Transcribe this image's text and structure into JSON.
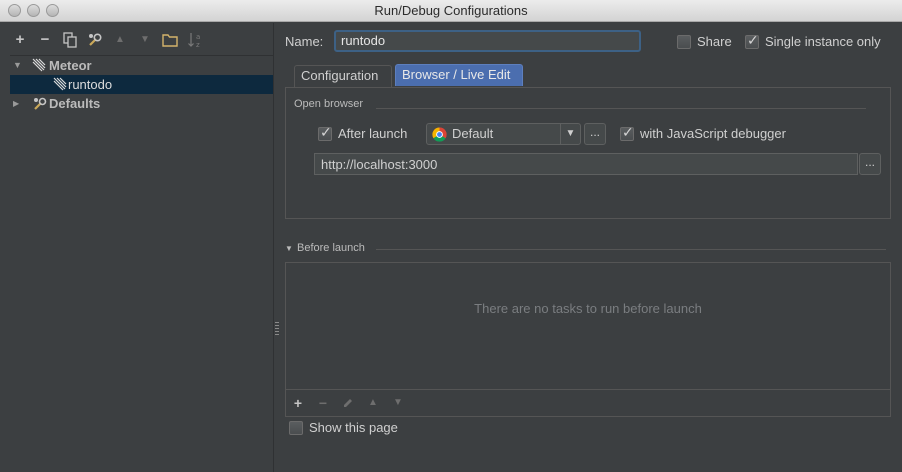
{
  "window": {
    "title": "Run/Debug Configurations"
  },
  "toolbar": {
    "add": "+",
    "remove": "−",
    "copy": "copy-icon",
    "edit_defaults": "wrench-icon",
    "move_up": "▲",
    "move_down": "▼",
    "folder": "folder-icon",
    "sort": "sort-alpha-icon"
  },
  "tree": {
    "group_label": "Meteor",
    "child_label": "runtodo",
    "defaults_label": "Defaults",
    "collapsed_arrow": "▶",
    "expanded_arrow": "▼"
  },
  "form": {
    "name_label": "Name:",
    "name_value": "runtodo",
    "share_label": "Share",
    "share_checked": false,
    "single_instance_label": "Single instance only",
    "single_instance_checked": true
  },
  "tabs": [
    {
      "label": "Configuration",
      "active": false
    },
    {
      "label": "Browser / Live Edit",
      "active": true
    }
  ],
  "open_browser": {
    "section_label": "Open browser",
    "after_launch_label": "After launch",
    "after_launch_checked": true,
    "browser_value": "Default",
    "browse_button": "...",
    "js_debugger_label": "with JavaScript debugger",
    "js_debugger_checked": true,
    "url_value": "http://localhost:3000",
    "url_button": "..."
  },
  "before_launch": {
    "section_label": "Before launch",
    "empty_text": "There are no tasks to run before launch",
    "add": "+",
    "remove": "−",
    "edit": "pencil-icon",
    "move_up": "▲",
    "move_down": "▼"
  },
  "footer": {
    "show_page_label": "Show this page",
    "show_page_checked": false
  },
  "colors": {
    "background": "#3c3f41",
    "selection": "#0d293e",
    "active_tab": "#4b6eaf",
    "focus_border": "#3d6185"
  }
}
